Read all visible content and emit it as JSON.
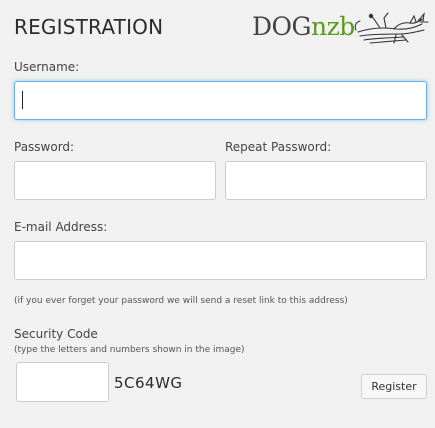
{
  "header": {
    "title": "REGISTRATION",
    "logo_dog": "DOG",
    "logo_nzb": "nzb"
  },
  "form": {
    "username": {
      "label": "Username:",
      "value": ""
    },
    "password": {
      "label": "Password:",
      "value": ""
    },
    "repeat_password": {
      "label": "Repeat Password:",
      "value": ""
    },
    "email": {
      "label": "E-mail Address:",
      "value": "",
      "hint": "(if you ever forget your password we will send a reset link to this address)"
    },
    "security_code": {
      "label": "Security Code",
      "hint": "(type the letters and numbers shown in the image)",
      "value": "",
      "captcha_text": "5C64WG"
    },
    "register_label": "Register"
  },
  "colors": {
    "background": "#f1f1f1",
    "logo_green": "#5a9a1c",
    "focus_border": "#66afe9"
  }
}
